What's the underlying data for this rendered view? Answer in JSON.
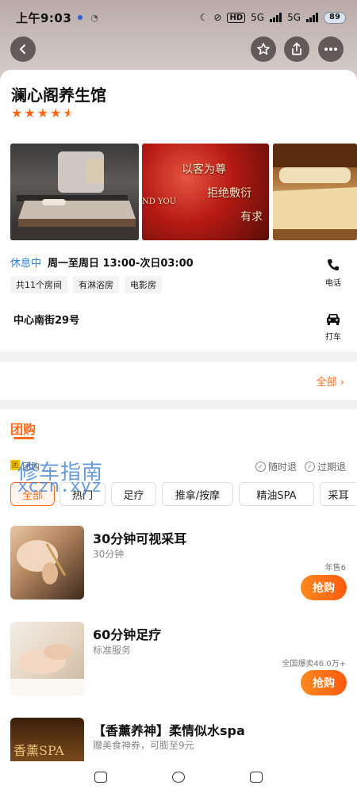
{
  "status_bar": {
    "time": "上午9:03",
    "network_1": "5G",
    "network_2": "5G",
    "hd": "HD",
    "battery": "89"
  },
  "header": {
    "back_icon": "back-arrow-icon",
    "favorite_icon": "star-outline-icon",
    "share_icon": "share-icon",
    "more_icon": "more-dots-icon"
  },
  "shop": {
    "name": "澜心阁养生馆",
    "rating_stars": 4.5,
    "photo_texts": [
      "以客为尊",
      "拒绝敷衍",
      "有求",
      "ND YOU"
    ],
    "status": "休息中",
    "hours": "周一至周日 13:00-次日03:00",
    "tags": [
      "共11个房间",
      "有淋浴房",
      "电影房"
    ],
    "phone_label": "电话",
    "address": "中心南街29号",
    "taxi_label": "打车"
  },
  "section_all": "全部 ›",
  "tuangou": {
    "title": "团购",
    "badge": "团",
    "badge_text": "团购",
    "guarantee_1": "随时退",
    "guarantee_2": "过期退",
    "categories": [
      "全部",
      "热门",
      "足疗",
      "推拿/按摩",
      "精油SPA",
      "采耳"
    ],
    "active_category": "全部"
  },
  "watermark": {
    "line1": "修车指南",
    "line2": "xczn.xyz"
  },
  "deals": [
    {
      "title": "30分钟可视采耳",
      "subtitle": "30分钟",
      "sales": "年售6",
      "button": "抢购"
    },
    {
      "title": "60分钟足疗",
      "subtitle": "标准服务",
      "sales": "全国爆卖46.0万+",
      "button": "抢购"
    },
    {
      "title": "【香薰养神】柔情似水spa",
      "subtitle": "赠美食神券，可膨至9元",
      "thumb_text": "香薰SPA",
      "sales": "",
      "button": ""
    }
  ],
  "colors": {
    "accent": "#ff6b1c",
    "status_blue": "#2e7ed6",
    "star": "#ff6a1a"
  }
}
